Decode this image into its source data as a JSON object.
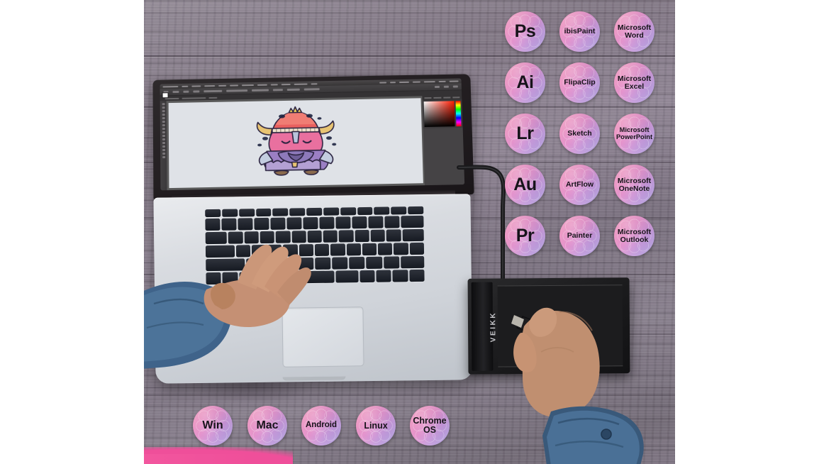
{
  "scene": {
    "title": "Graphics tablet compatibility product image",
    "surface": "weathered grey-purple wood table",
    "devices": {
      "laptop": {
        "type": "macbook-pro",
        "keyboard_layout": "QWERTZ",
        "screen_app": "Adobe Photoshop"
      },
      "tablet": {
        "brand": "VEIKK",
        "type": "pen-tablet",
        "stylus": "passive-pen"
      }
    },
    "artwork": {
      "subject": "sleeping viking monster with crown and horns"
    }
  },
  "app_badges": [
    {
      "label": "Ps",
      "style": "letters"
    },
    {
      "label": "ibisPaint",
      "style": "words"
    },
    {
      "label": "Microsoft\nWord",
      "style": "words"
    },
    {
      "label": "Ai",
      "style": "letters"
    },
    {
      "label": "FlipaClip",
      "style": "words"
    },
    {
      "label": "Microsoft\nExcel",
      "style": "words"
    },
    {
      "label": "Lr",
      "style": "letters"
    },
    {
      "label": "Sketch",
      "style": "words"
    },
    {
      "label": "Microsoft\nPowerPoint",
      "style": "words-small"
    },
    {
      "label": "Au",
      "style": "letters"
    },
    {
      "label": "ArtFlow",
      "style": "words"
    },
    {
      "label": "Microsoft\nOneNote",
      "style": "words"
    },
    {
      "label": "Pr",
      "style": "letters"
    },
    {
      "label": "Painter",
      "style": "words"
    },
    {
      "label": "Microsoft\nOutlook",
      "style": "words"
    }
  ],
  "os_badges": [
    {
      "label": "Win",
      "style": "lg"
    },
    {
      "label": "Mac",
      "style": "lg"
    },
    {
      "label": "Android",
      "style": "xs"
    },
    {
      "label": "Linux",
      "style": "sm"
    },
    {
      "label": "Chrome\nOS",
      "style": "sm"
    }
  ],
  "tablet": {
    "brand_text": "VEIKK"
  },
  "colors": {
    "badge_pink": "#f07fbe",
    "badge_purple": "#a79bdf",
    "badge_text": "#17131a",
    "wood": "#7d7280",
    "denim": "#3c5f81",
    "skin": "#bc8666",
    "laptop_body": "#d8dbe0",
    "screen_bezel": "#1a1619",
    "accent_strip": "#ef4f9a"
  }
}
